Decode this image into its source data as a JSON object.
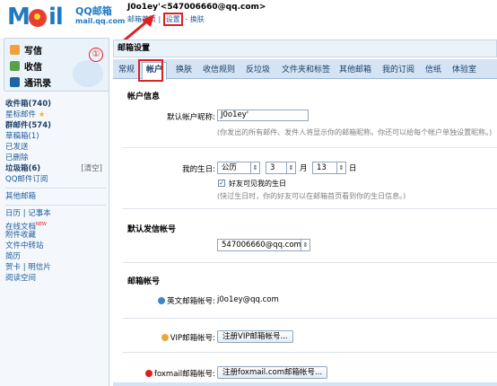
{
  "header": {
    "brand_box_big": "QQ邮箱",
    "brand_box_small": "mail.qq.com",
    "account_line": "J0o1ey'<547006660@qq.com>",
    "link_home": "邮箱首页",
    "link_separator": "|",
    "link_settings": "设置",
    "link_skin": "- 换肤"
  },
  "sidebar": {
    "quick": {
      "write": "写信",
      "inbox": "收信",
      "contacts": "通讯录",
      "annotation": "①"
    },
    "folders": [
      "收件箱(740)",
      "星标邮件",
      "群邮件(574)",
      "草稿箱(1)",
      "已发送",
      "已删除",
      "垃圾箱(6)",
      "QQ邮件订阅"
    ],
    "spam_clear": "[清空]",
    "other": "其他邮箱",
    "tools": [
      "日历 | 记事本",
      "在线文档",
      "附件收藏",
      "文件中转站",
      "贺卡 | 明信片",
      "阅读空间"
    ],
    "tools_alt": "简历",
    "new_badge": "NEW"
  },
  "main": {
    "title": "邮箱设置",
    "tabs": [
      "常规",
      "帐户",
      "换肤",
      "收信规则",
      "反垃圾",
      "文件夹和标签",
      "其他邮箱",
      "我的订阅",
      "信纸",
      "体验室"
    ],
    "active_tab": "帐户",
    "account_info": {
      "title": "帐户信息",
      "nickname_label": "默认帐户昵称:",
      "nickname_value": "J0o1ey'",
      "nickname_hint": "(你发出的所有邮件、发件人将显示你的邮箱昵称。你还可以给每个帐户单独设置昵称。)",
      "birthday_label": "我的生日:",
      "calendar": "公历",
      "month": "3",
      "month_unit": "月",
      "day": "13",
      "day_unit": "日",
      "friends_see": "好友可见我的生日",
      "birthday_hint": "(快过生日时，你的好友可以在邮箱首页看到你的生日信息。)"
    },
    "default_sender": {
      "title": "默认发信帐号",
      "value": "547006660@qq.com"
    },
    "mail_accounts": {
      "title": "邮箱帐号",
      "english_label": "英文邮箱帐号:",
      "english_value": "j0o1ey@qq.com",
      "vip_label": "VIP邮箱帐号:",
      "vip_button": "注册VIP邮箱帐号...",
      "foxmail_label": "foxmail邮箱帐号:",
      "foxmail_button": "注册foxmail.com邮箱帐号..."
    }
  },
  "colors": {
    "brand_blue": "#1f79c4",
    "annotation_red": "#e02020",
    "tab_bar": "#d4e4f4",
    "link_blue": "#1d5b9b"
  }
}
